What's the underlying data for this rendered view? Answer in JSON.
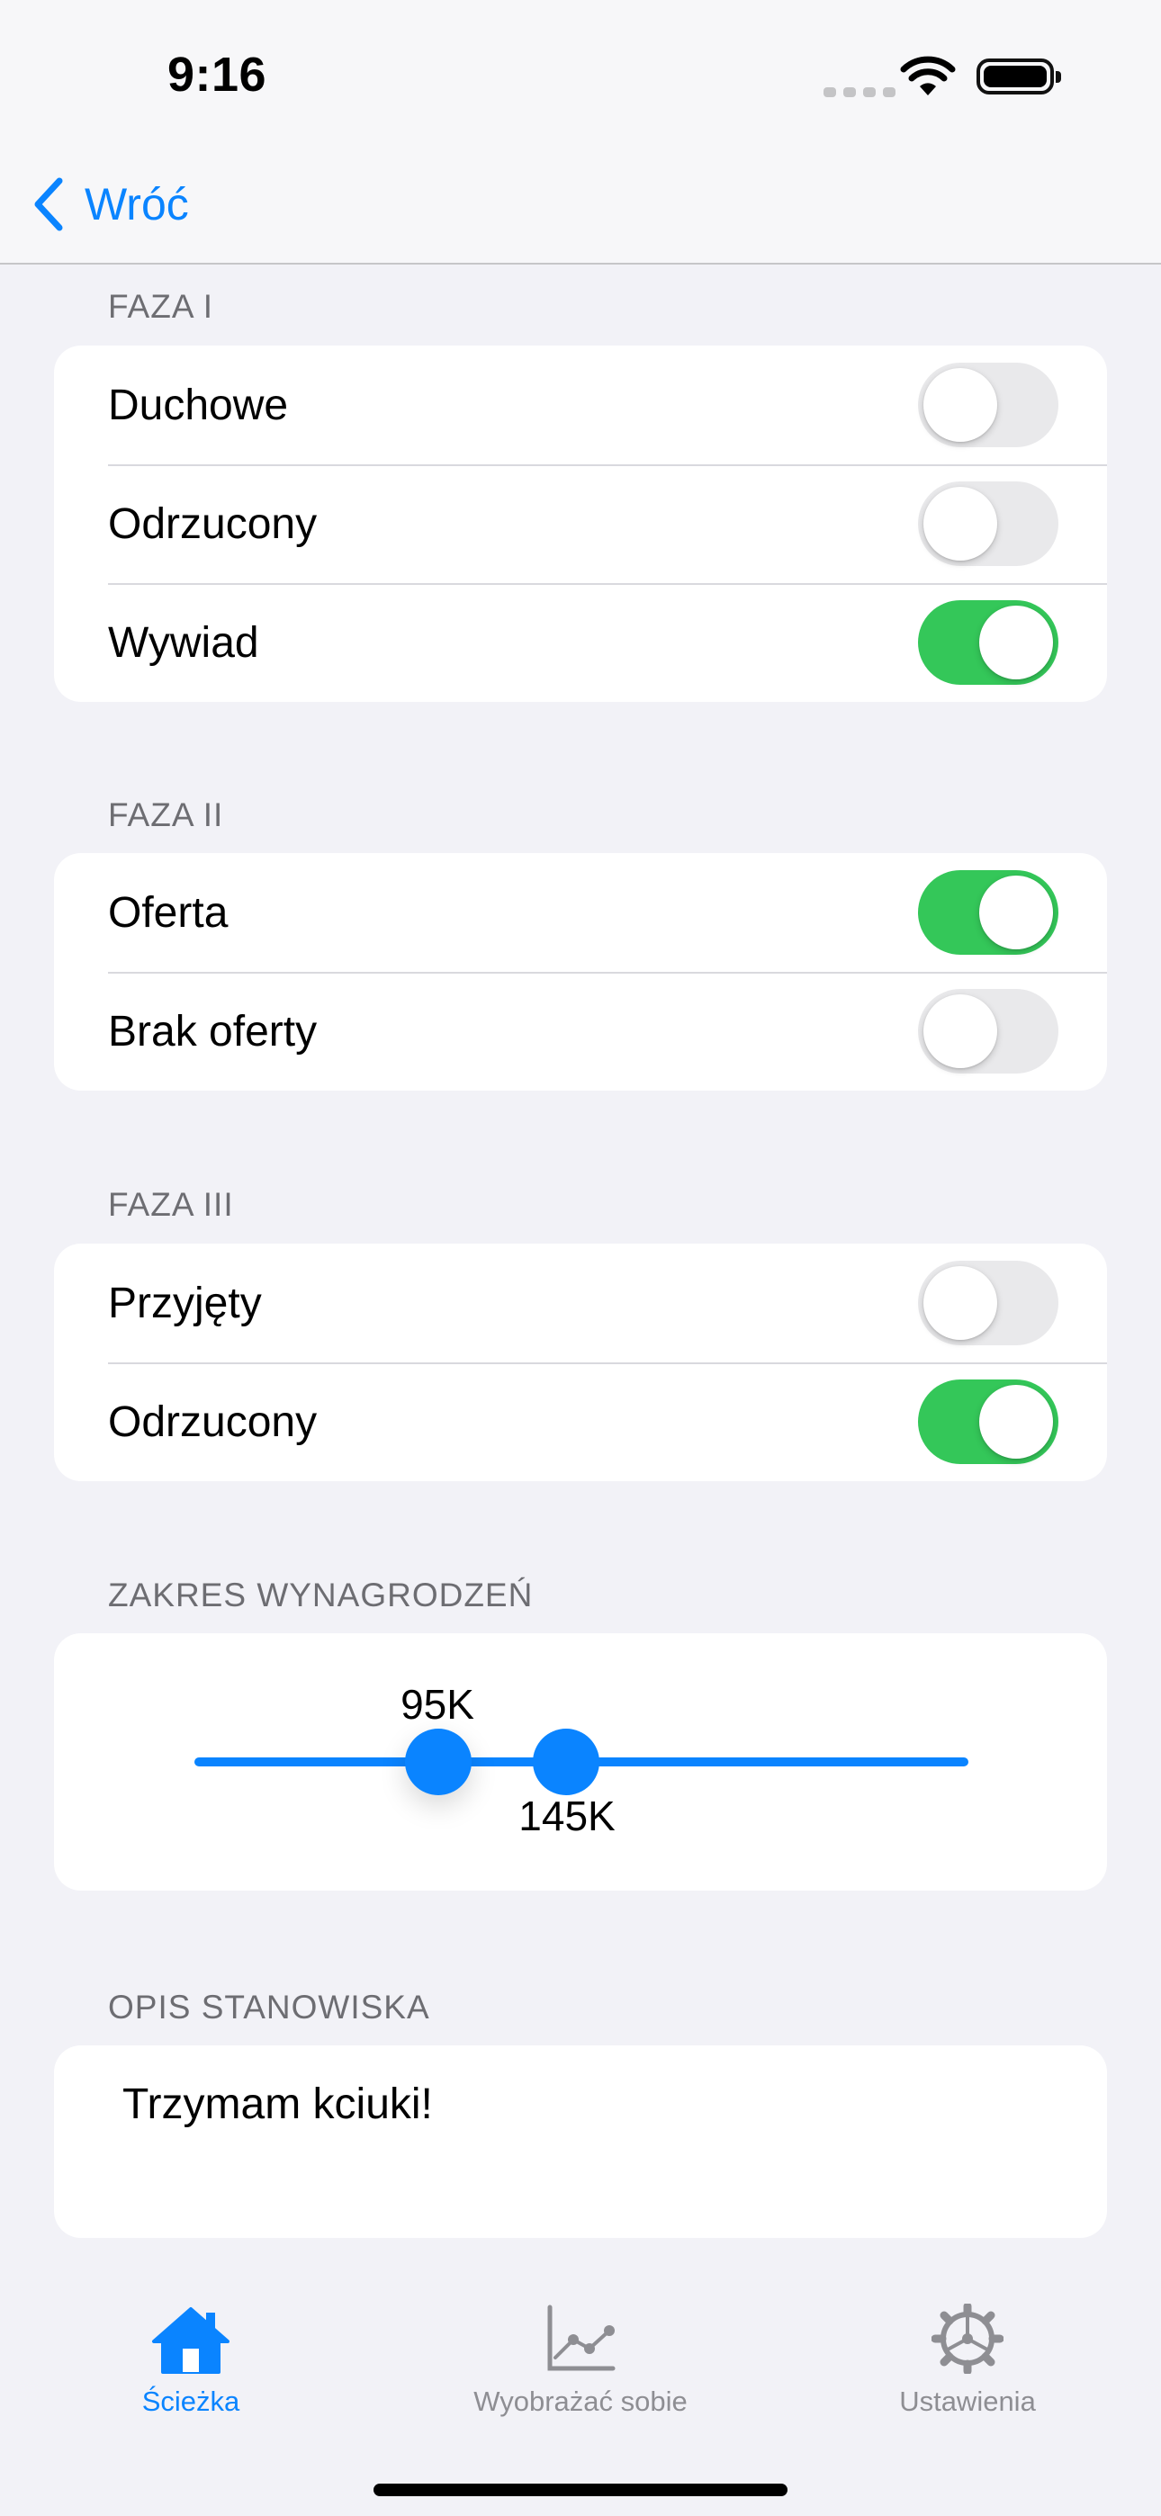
{
  "status_bar": {
    "time": "9:16"
  },
  "nav": {
    "back_label": "Wróć"
  },
  "sections": [
    {
      "header": "FAZA I",
      "rows": [
        {
          "label": "Duchowe",
          "on": false
        },
        {
          "label": "Odrzucony",
          "on": false
        },
        {
          "label": "Wywiad",
          "on": true
        }
      ]
    },
    {
      "header": "FAZA II",
      "rows": [
        {
          "label": "Oferta",
          "on": true
        },
        {
          "label": "Brak oferty",
          "on": false
        }
      ]
    },
    {
      "header": "FAZA III",
      "rows": [
        {
          "label": "Przyjęty",
          "on": false
        },
        {
          "label": "Odrzucony",
          "on": true
        }
      ]
    }
  ],
  "salary": {
    "header": "ZAKRES WYNAGRODZEŃ",
    "low_label": "95K",
    "high_label": "145K"
  },
  "description": {
    "header": "OPIS STANOWISKA",
    "text": "Trzymam kciuki!"
  },
  "tabs": [
    {
      "label": "Ścieżka",
      "icon": "house-icon",
      "active": true
    },
    {
      "label": "Wyobrażać sobie",
      "icon": "chart-line-icon",
      "active": false
    },
    {
      "label": "Ustawienia",
      "icon": "gear-icon",
      "active": false
    }
  ],
  "colors": {
    "accent": "#0a84ff",
    "toggle_on": "#34c759",
    "background": "#f2f2f7"
  }
}
